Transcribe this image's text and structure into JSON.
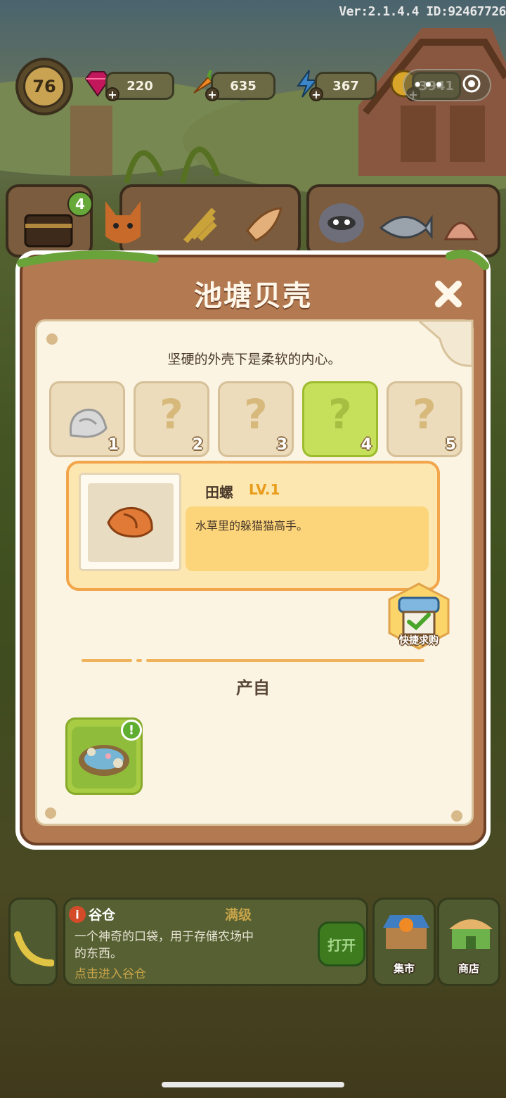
{
  "version_text": "Ver:2.1.4.4 ID:92467726",
  "player": {
    "level": "76"
  },
  "resources": {
    "gems": "220",
    "carrots": "635",
    "energy": "367",
    "coins": "3941"
  },
  "inventory_badge": "4",
  "modal": {
    "title": "池塘贝壳",
    "description": "坚硬的外壳下是柔软的内心。",
    "slots": [
      {
        "number": "1",
        "content": "shell"
      },
      {
        "number": "2",
        "content": "?"
      },
      {
        "number": "3",
        "content": "?"
      },
      {
        "number": "4",
        "content": "?"
      },
      {
        "number": "5",
        "content": "?"
      }
    ],
    "selected_slot": 4,
    "item": {
      "name": "田螺",
      "level": "LV.1",
      "description": "水草里的躲猫猫高手。"
    },
    "quick_buy_label": "快捷求购",
    "source_heading": "产自",
    "source_badge": "!"
  },
  "building": {
    "name": "谷仓",
    "status": "满级",
    "description": "一个神奇的口袋，用于存储农场中的东西。",
    "link": "点击进入谷仓",
    "open_label": "打开"
  },
  "nav": {
    "market": "集市",
    "shop": "商店"
  },
  "colors": {
    "modal_wood": "#b37a52",
    "paper": "#fbf4e2",
    "selected_slot": "#c7e05c",
    "card_border": "#f2a54a",
    "level_text": "#e99c1a"
  }
}
